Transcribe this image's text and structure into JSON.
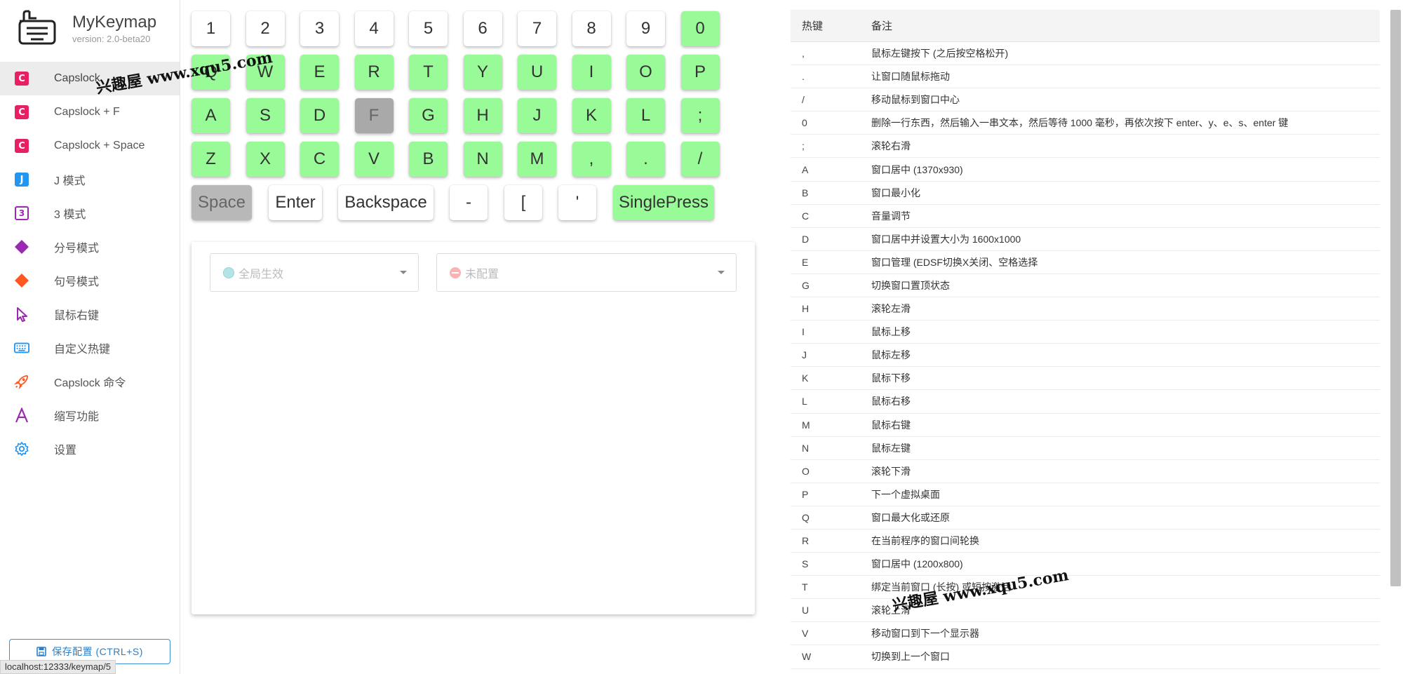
{
  "app": {
    "title": "MyKeymap",
    "version": "version: 2.0-beta20"
  },
  "sidebar": {
    "items": [
      {
        "label": "Capslock",
        "icon": "capslock-c-icon",
        "badge": "C",
        "color": "#e91e63",
        "active": true
      },
      {
        "label": "Capslock + F",
        "icon": "capslock-c-icon",
        "badge": "C",
        "color": "#e91e63"
      },
      {
        "label": "Capslock + Space",
        "icon": "capslock-c-icon",
        "badge": "C",
        "color": "#e91e63"
      },
      {
        "label": "J 模式",
        "icon": "j-mode-icon",
        "badge": "J",
        "color": "#2196f3"
      },
      {
        "label": "3 模式",
        "icon": "three-mode-icon",
        "badge": "3",
        "color": "#9c27b0"
      },
      {
        "label": "分号模式",
        "icon": "diamond-purple-icon",
        "color": "#9c27b0"
      },
      {
        "label": "句号模式",
        "icon": "diamond-orange-icon",
        "color": "#ff5722"
      },
      {
        "label": "鼠标右键",
        "icon": "mouse-pointer-icon",
        "color": "#9c27b0"
      },
      {
        "label": "自定义热键",
        "icon": "keyboard-icon",
        "color": "#2196f3"
      },
      {
        "label": "Capslock 命令",
        "icon": "rocket-icon",
        "color": "#ff5722"
      },
      {
        "label": "缩写功能",
        "icon": "abbreviation-a-icon",
        "color": "#9c27b0"
      },
      {
        "label": "设置",
        "icon": "gear-icon",
        "color": "#2196f3"
      }
    ],
    "save_label": "保存配置 (CTRL+S)",
    "status_url": "localhost:12333/keymap/5"
  },
  "keyboard": {
    "rows": [
      [
        {
          "label": "1",
          "state": "white"
        },
        {
          "label": "2",
          "state": "white"
        },
        {
          "label": "3",
          "state": "white"
        },
        {
          "label": "4",
          "state": "white"
        },
        {
          "label": "5",
          "state": "white"
        },
        {
          "label": "6",
          "state": "white"
        },
        {
          "label": "7",
          "state": "white"
        },
        {
          "label": "8",
          "state": "white"
        },
        {
          "label": "9",
          "state": "white"
        },
        {
          "label": "0",
          "state": "green"
        }
      ],
      [
        {
          "label": "Q",
          "state": "green"
        },
        {
          "label": "W",
          "state": "green"
        },
        {
          "label": "E",
          "state": "green"
        },
        {
          "label": "R",
          "state": "green"
        },
        {
          "label": "T",
          "state": "green"
        },
        {
          "label": "Y",
          "state": "green"
        },
        {
          "label": "U",
          "state": "green"
        },
        {
          "label": "I",
          "state": "green"
        },
        {
          "label": "O",
          "state": "green"
        },
        {
          "label": "P",
          "state": "green"
        }
      ],
      [
        {
          "label": "A",
          "state": "green"
        },
        {
          "label": "S",
          "state": "green"
        },
        {
          "label": "D",
          "state": "green"
        },
        {
          "label": "F",
          "state": "gray"
        },
        {
          "label": "G",
          "state": "green"
        },
        {
          "label": "H",
          "state": "green"
        },
        {
          "label": "J",
          "state": "green"
        },
        {
          "label": "K",
          "state": "green"
        },
        {
          "label": "L",
          "state": "green"
        },
        {
          "label": ";",
          "state": "green"
        }
      ],
      [
        {
          "label": "Z",
          "state": "green"
        },
        {
          "label": "X",
          "state": "green"
        },
        {
          "label": "C",
          "state": "green"
        },
        {
          "label": "V",
          "state": "green"
        },
        {
          "label": "B",
          "state": "green"
        },
        {
          "label": "N",
          "state": "green"
        },
        {
          "label": "M",
          "state": "green"
        },
        {
          "label": ",",
          "state": "green"
        },
        {
          "label": ".",
          "state": "green"
        },
        {
          "label": "/",
          "state": "green"
        }
      ]
    ],
    "special": [
      {
        "label": "Space",
        "state": "space"
      },
      {
        "label": "Enter",
        "state": "white"
      },
      {
        "label": "Backspace",
        "state": "white"
      },
      {
        "label": "-",
        "state": "white"
      },
      {
        "label": "[",
        "state": "white"
      },
      {
        "label": "'",
        "state": "white"
      },
      {
        "label": "SinglePress",
        "state": "green"
      }
    ]
  },
  "config_panel": {
    "scope_select": {
      "value": "全局生效"
    },
    "action_select": {
      "value": "未配置"
    }
  },
  "table": {
    "headers": {
      "hotkey": "热键",
      "note": "备注"
    },
    "rows": [
      {
        "key": ",",
        "note": "鼠标左键按下 (之后按空格松开)"
      },
      {
        "key": ".",
        "note": "让窗口随鼠标拖动"
      },
      {
        "key": "/",
        "note": "移动鼠标到窗口中心"
      },
      {
        "key": "0",
        "note": "删除一行东西，然后输入一串文本，然后等待 1000 毫秒，再依次按下 enter、y、e、s、enter 键"
      },
      {
        "key": ";",
        "note": "滚轮右滑"
      },
      {
        "key": "A",
        "note": "窗口居中 (1370x930)"
      },
      {
        "key": "B",
        "note": "窗口最小化"
      },
      {
        "key": "C",
        "note": "音量调节"
      },
      {
        "key": "D",
        "note": "窗口居中并设置大小为 1600x1000"
      },
      {
        "key": "E",
        "note": "窗口管理 (EDSF切换X关闭、空格选择"
      },
      {
        "key": "G",
        "note": "切换窗口置顶状态"
      },
      {
        "key": "H",
        "note": "滚轮左滑"
      },
      {
        "key": "I",
        "note": "鼠标上移"
      },
      {
        "key": "J",
        "note": "鼠标左移"
      },
      {
        "key": "K",
        "note": "鼠标下移"
      },
      {
        "key": "L",
        "note": "鼠标右移"
      },
      {
        "key": "M",
        "note": "鼠标右键"
      },
      {
        "key": "N",
        "note": "鼠标左键"
      },
      {
        "key": "O",
        "note": "滚轮下滑"
      },
      {
        "key": "P",
        "note": "下一个虚拟桌面"
      },
      {
        "key": "Q",
        "note": "窗口最大化或还原"
      },
      {
        "key": "R",
        "note": "在当前程序的窗口间轮换"
      },
      {
        "key": "S",
        "note": "窗口居中 (1200x800)"
      },
      {
        "key": "T",
        "note": "绑定当前窗口 (长按) 或短按激活"
      },
      {
        "key": "U",
        "note": "滚轮上滑"
      },
      {
        "key": "V",
        "note": "移动窗口到下一个显示器"
      },
      {
        "key": "W",
        "note": "切换到上一个窗口"
      }
    ]
  },
  "watermarks": [
    "兴趣屋 www.xqu5.com",
    "兴趣屋 www.xqu5.com"
  ]
}
